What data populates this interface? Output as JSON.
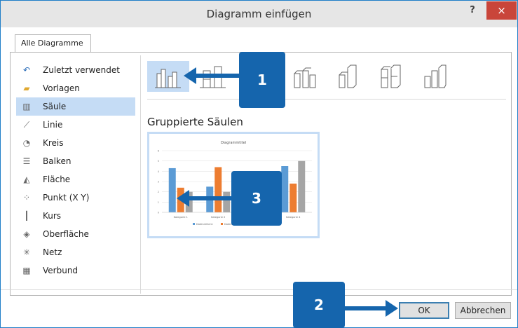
{
  "window": {
    "title": "Diagramm einfügen",
    "help_glyph": "?",
    "close_glyph": "×"
  },
  "tabs": [
    {
      "label": "Alle Diagramme"
    }
  ],
  "sidebar": {
    "items": [
      {
        "label": "Zuletzt verwendet",
        "icon": "recent-icon",
        "glyph": "↶"
      },
      {
        "label": "Vorlagen",
        "icon": "folder-icon",
        "glyph": "▰"
      },
      {
        "label": "Säule",
        "icon": "column-chart-icon",
        "glyph": "▥",
        "selected": true
      },
      {
        "label": "Linie",
        "icon": "line-chart-icon",
        "glyph": "⟋"
      },
      {
        "label": "Kreis",
        "icon": "pie-chart-icon",
        "glyph": "◔"
      },
      {
        "label": "Balken",
        "icon": "bar-chart-icon",
        "glyph": "☰"
      },
      {
        "label": "Fläche",
        "icon": "area-chart-icon",
        "glyph": "◭"
      },
      {
        "label": "Punkt (X Y)",
        "icon": "scatter-chart-icon",
        "glyph": "⁘"
      },
      {
        "label": "Kurs",
        "icon": "stock-chart-icon",
        "glyph": "┃"
      },
      {
        "label": "Oberfläche",
        "icon": "surface-chart-icon",
        "glyph": "◈"
      },
      {
        "label": "Netz",
        "icon": "radar-chart-icon",
        "glyph": "✳"
      },
      {
        "label": "Verbund",
        "icon": "combo-chart-icon",
        "glyph": "▦"
      }
    ]
  },
  "subtypes": {
    "selected_index": 0,
    "icons": [
      "clustered-column-icon",
      "stacked-column-icon",
      "3d-column-icon",
      "3d-clustered-column-icon",
      "3d-stacked-column-icon",
      "3d-100-column-icon",
      "3d-column-variant-icon"
    ]
  },
  "preview": {
    "heading": "Gruppierte Säulen",
    "chart_data": {
      "type": "bar",
      "title": "Diagrammtitel",
      "categories": [
        "Kategorie 1",
        "Kategorie 2",
        "Kategorie 3",
        "Kategorie 4"
      ],
      "series": [
        {
          "name": "Datenreihen1",
          "values": [
            4.3,
            2.5,
            3.5,
            4.5
          ],
          "color": "#5b9bd5"
        },
        {
          "name": "Datenreihen2",
          "values": [
            2.4,
            4.4,
            1.8,
            2.8
          ],
          "color": "#ed7d31"
        },
        {
          "name": "Datenreihen3",
          "values": [
            2.0,
            2.0,
            3.0,
            5.0
          ],
          "color": "#a5a5a5"
        }
      ],
      "ylim": [
        0,
        6
      ],
      "yticks": [
        "0",
        "1",
        "2",
        "3",
        "4",
        "5",
        "6"
      ],
      "grid": true,
      "legend": "bottom"
    }
  },
  "buttons": {
    "ok": "OK",
    "cancel": "Abbrechen"
  },
  "callouts": [
    "1",
    "2",
    "3"
  ],
  "accent_color": "#1565ad"
}
